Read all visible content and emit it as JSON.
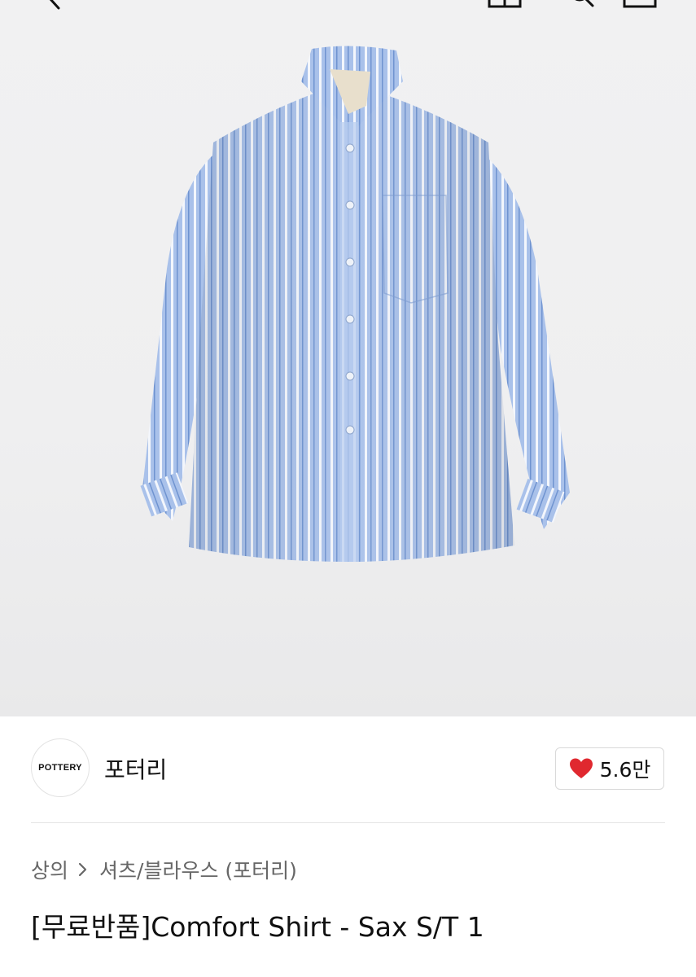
{
  "header": {
    "icons": [
      "back-icon",
      "shopping-bag-icon",
      "search-icon",
      "home-icon"
    ]
  },
  "product": {
    "image_alt": "blue striped shirt",
    "brand": {
      "logo_text": "POTTERY",
      "name": "포터리"
    },
    "likes": {
      "count": "5.6만",
      "icon": "heart-icon",
      "color": "#e0282f"
    },
    "breadcrumb": {
      "category": "상의",
      "subcategory": "셔츠/블라우스 (포터리)"
    },
    "title": "[무료반품]Comfort Shirt - Sax S/T 1"
  }
}
